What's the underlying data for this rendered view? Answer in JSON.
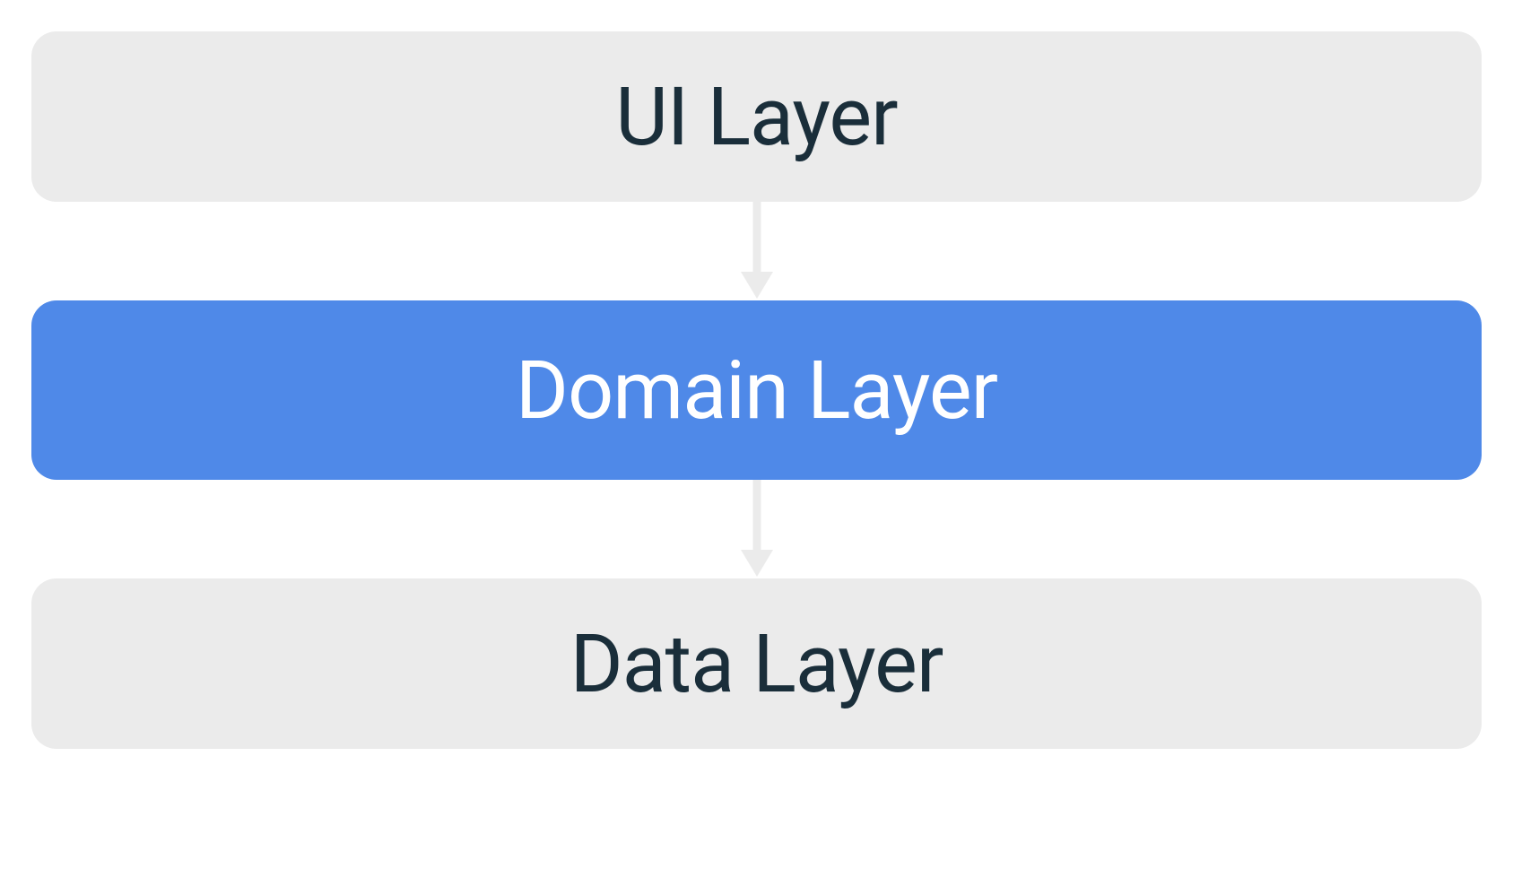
{
  "diagram": {
    "layers": [
      {
        "label": "UI Layer",
        "highlighted": false
      },
      {
        "label": "Domain Layer",
        "highlighted": true
      },
      {
        "label": "Data Layer",
        "highlighted": false
      }
    ],
    "colors": {
      "gray_bg": "#ebebeb",
      "gray_text": "#1a2e3a",
      "blue_bg": "#4f89e8",
      "blue_text": "#ffffff",
      "arrow": "#ebebeb"
    },
    "flow_direction": "top-to-bottom"
  }
}
